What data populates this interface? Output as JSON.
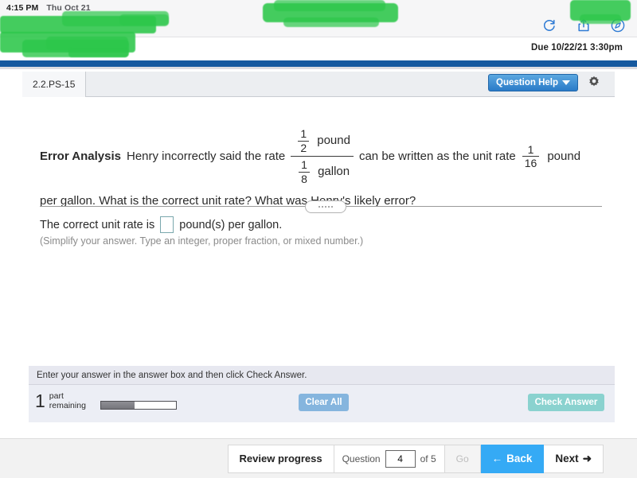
{
  "status_bar": {
    "time": "4:15 PM",
    "date": "Thu Oct 21"
  },
  "browser": {
    "icons": [
      "refresh-icon",
      "share-icon",
      "compass-icon"
    ]
  },
  "assignment": {
    "due_text": "Due 10/22/21 3:30pm"
  },
  "question_header": {
    "tab_label": "2.2.PS-15",
    "help_label": "Question Help",
    "help_caret": "▼",
    "settings_icon": "gear-icon"
  },
  "problem": {
    "label": "Error Analysis",
    "sentence_start": "Henry incorrectly said the rate",
    "complex_fraction": {
      "numerator": {
        "fraction": {
          "num": "1",
          "den": "2"
        },
        "unit": "pound"
      },
      "denominator": {
        "fraction": {
          "num": "1",
          "den": "8"
        },
        "unit": "gallon"
      }
    },
    "sentence_middle": "can be written as the unit rate",
    "unit_rate_fraction": {
      "num": "1",
      "den": "16"
    },
    "unit_rate_unit": "pound",
    "sentence_end": "per gallon. What is the correct unit rate? What was Henry's likely error?"
  },
  "answer": {
    "prefix": "The correct unit rate is",
    "value": "",
    "suffix": "pound(s) per gallon.",
    "note": "(Simplify your answer. Type an integer, proper fraction, or mixed number.)"
  },
  "footer": {
    "hint": "Enter your answer in the answer box and then click Check Answer.",
    "parts_remaining_count": "1",
    "parts_remaining_label_line1": "part",
    "parts_remaining_label_line2": "remaining",
    "progress_percent": 45,
    "clear_all_label": "Clear All",
    "check_answer_label": "Check Answer"
  },
  "bottom_nav": {
    "review_label": "Review progress",
    "question_word": "Question",
    "question_number": "4",
    "of_total": "of 5",
    "go_label": "Go",
    "back_label": "Back",
    "back_arrow": "←",
    "next_label": "Next",
    "next_arrow": "➜"
  },
  "colors": {
    "brand_blue": "#16599f",
    "help_blue": "#2a7bc8",
    "back_blue": "#35aaf5",
    "check_teal": "#8ad2cf",
    "clear_blue": "#85b5de",
    "redaction_green": "#2cc74a"
  }
}
